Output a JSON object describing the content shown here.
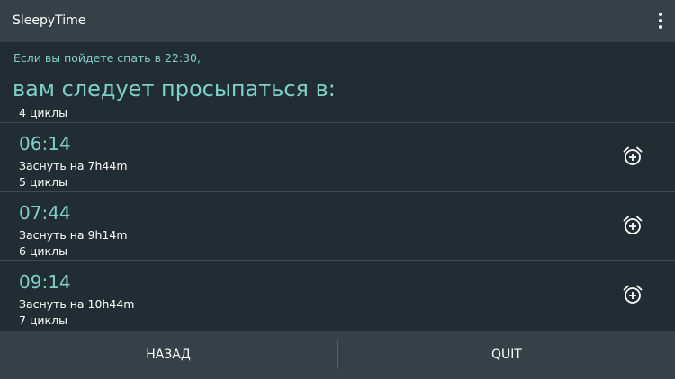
{
  "app": {
    "title": "SleepyTime"
  },
  "header": {
    "subtitle": "Если вы пойдете спать в 22:30,",
    "heading": "вам следует просыпаться в:"
  },
  "list": {
    "partial_cycles": "4 циклы",
    "items": [
      {
        "time": "06:14",
        "sleep": "Заснуть на 7h44m",
        "cycles": "5 циклы",
        "icon": "alarm-add-icon"
      },
      {
        "time": "07:44",
        "sleep": "Заснуть на 9h14m",
        "cycles": "6 циклы",
        "icon": "alarm-add-icon"
      },
      {
        "time": "09:14",
        "sleep": "Заснуть на 10h44m",
        "cycles": "7 циклы",
        "icon": "alarm-add-icon"
      }
    ]
  },
  "footer": {
    "back_label": "НАЗАД",
    "quit_label": "QUIT"
  },
  "colors": {
    "background": "#222d33",
    "bars": "#364147",
    "accent": "#7ed0c8",
    "text": "#ffffff"
  }
}
